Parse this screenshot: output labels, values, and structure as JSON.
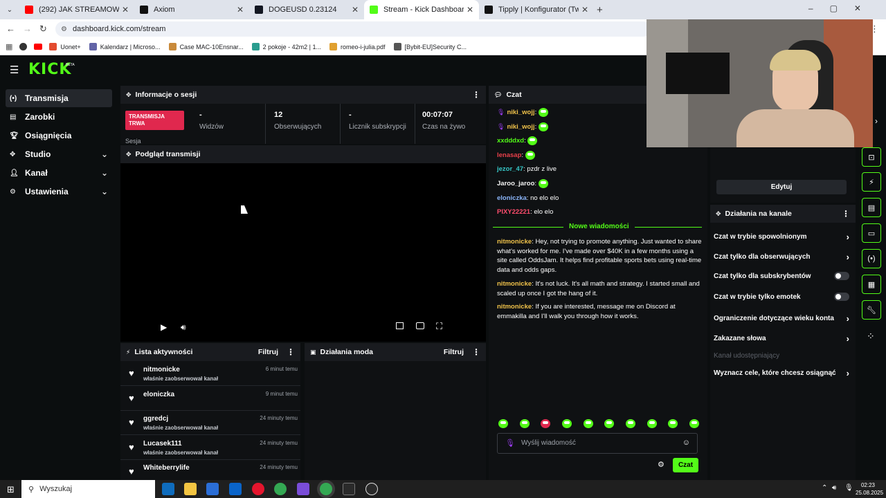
{
  "browser": {
    "tabs": [
      {
        "title": "(292) JAK STREAMOWAĆ NA KICK",
        "fav_color": "#ff0000"
      },
      {
        "title": "Axiom",
        "fav_color": "#111111"
      },
      {
        "title": "DOGEUSD 0.23124",
        "fav_color": "#131722"
      },
      {
        "title": "Stream - Kick Dashboard",
        "fav_color": "#53fc18"
      },
      {
        "title": "Tipply | Konfigurator (Twój cel)",
        "fav_color": "#111111"
      }
    ],
    "url": "dashboard.kick.com/stream",
    "bookmarks": [
      {
        "label": "Uonet+",
        "color": "#e34b2f"
      },
      {
        "label": "Kalendarz | Microso...",
        "color": "#6264a7"
      },
      {
        "label": "Case MAC-10Ensnar...",
        "color": "#c98a3b"
      },
      {
        "label": "2 pokoje - 42m2 | 1...",
        "color": "#2a9d8f"
      },
      {
        "label": "romeo-i-julia.pdf",
        "color": "#e0a030"
      },
      {
        "label": "[Bybit-EU]Security C...",
        "color": "#555555"
      }
    ]
  },
  "app": {
    "logo": "KICK",
    "logo_badge": "BETA",
    "sidebar": [
      {
        "label": "Transmisja",
        "icon": "broadcast-icon",
        "active": true,
        "expand": false
      },
      {
        "label": "Zarobki",
        "icon": "wallet-icon",
        "active": false,
        "expand": false
      },
      {
        "label": "Osiągnięcia",
        "icon": "trophy-icon",
        "active": false,
        "expand": false
      },
      {
        "label": "Studio",
        "icon": "studio-icon",
        "active": false,
        "expand": true
      },
      {
        "label": "Kanał",
        "icon": "user-icon",
        "active": false,
        "expand": true
      },
      {
        "label": "Ustawienia",
        "icon": "gear-icon",
        "active": false,
        "expand": true
      }
    ],
    "session": {
      "title": "Informacje o sesji",
      "badge": "TRANSMISJA TRWA",
      "badge_sub": "Sesja",
      "stats": [
        {
          "value": "-",
          "label": "Widzów"
        },
        {
          "value": "12",
          "label": "Obserwujących"
        },
        {
          "value": "-",
          "label": "Licznik subskrypcji"
        },
        {
          "value": "00:07:07",
          "label": "Czas na żywo"
        }
      ]
    },
    "preview": {
      "title": "Podgląd transmisji"
    },
    "activity": {
      "title": "Lista aktywności",
      "filter": "Filtruj",
      "items": [
        {
          "user": "nitmonicke",
          "text": "właśnie zaobserwował kanał",
          "time": "6 minut temu"
        },
        {
          "user": "eloniczka",
          "text": "",
          "time": "9 minut temu"
        },
        {
          "user": "ggredcj",
          "text": "właśnie zaobserwował kanał",
          "time": "24 minuty temu"
        },
        {
          "user": "Lucasek111",
          "text": "właśnie zaobserwował kanał",
          "time": "24 minuty temu"
        },
        {
          "user": "Whiteberrylife",
          "text": "",
          "time": "24 minuty temu"
        }
      ]
    },
    "mod": {
      "title": "Działania moda",
      "filter": "Filtruj"
    },
    "chat": {
      "title": "Czat",
      "messages": [
        {
          "user": "niki_wojj",
          "color": "#f0c24a",
          "text": "",
          "emote": true,
          "mic": true
        },
        {
          "user": "niki_wojj",
          "color": "#f0c24a",
          "text": "",
          "emote": true,
          "mic": true
        },
        {
          "user": "xxdddxd",
          "color": "#53fc18",
          "text": "",
          "emote": true,
          "mic": false
        },
        {
          "user": "lenasap",
          "color": "#e8404a",
          "text": "",
          "emote": true,
          "mic": false
        },
        {
          "user": "jezor_47",
          "color": "#36c7c7",
          "text": "pzdr z live",
          "emote": false,
          "mic": false
        },
        {
          "user": "Jaroo_jaroo",
          "color": "#f5f5f5",
          "text": "",
          "emote": true,
          "mic": false
        },
        {
          "user": "eloniczka",
          "color": "#8ab4f8",
          "text": "no elo elo",
          "emote": false,
          "mic": false
        },
        {
          "user": "PIXY22221",
          "color": "#ff4d6d",
          "text": "elo elo",
          "emote": false,
          "mic": false
        }
      ],
      "new_divider": "Nowe wiadomości",
      "new_messages": [
        {
          "user": "nitmonicke",
          "text": "Hey, not trying to promote anything. Just wanted to share what's worked for me. I've made over $40K in a few months using a site called OddsJam. It helps find profitable sports bets using real-time data and odds gaps."
        },
        {
          "user": "nitmonicke",
          "text": "It's not luck. It's all math and strategy. I started small and scaled up once I got the hang of it."
        },
        {
          "user": "nitmonicke",
          "text": "If you are interested, message me on Discord at emmakilla and I'll walk you through how it works."
        }
      ],
      "input_placeholder": "Wyślij wiadomość",
      "send_label": "Czat"
    },
    "right_panel": {
      "edit_label": "Edytuj",
      "channel_title": "Działania na kanale",
      "options": [
        {
          "label": "Czat w trybie spowolnionym",
          "kind": "arrow"
        },
        {
          "label": "Czat tylko dla obserwujących",
          "kind": "arrow"
        },
        {
          "label": "Czat tylko dla subskrybentów",
          "kind": "toggle"
        },
        {
          "label": "Czat w trybie tylko emotek",
          "kind": "toggle"
        },
        {
          "label": "Ograniczenie dotyczące wieku konta",
          "kind": "arrow"
        },
        {
          "label": "Zakazane słowa",
          "kind": "arrow"
        },
        {
          "label": "Kanał udostępniający",
          "kind": "disabled"
        },
        {
          "label": "Wyznacz cele, które chcesz osiągnąć",
          "kind": "arrow"
        }
      ]
    }
  },
  "taskbar": {
    "search": "Wyszukaj",
    "time": "02:23",
    "date": "25.08.2025"
  }
}
